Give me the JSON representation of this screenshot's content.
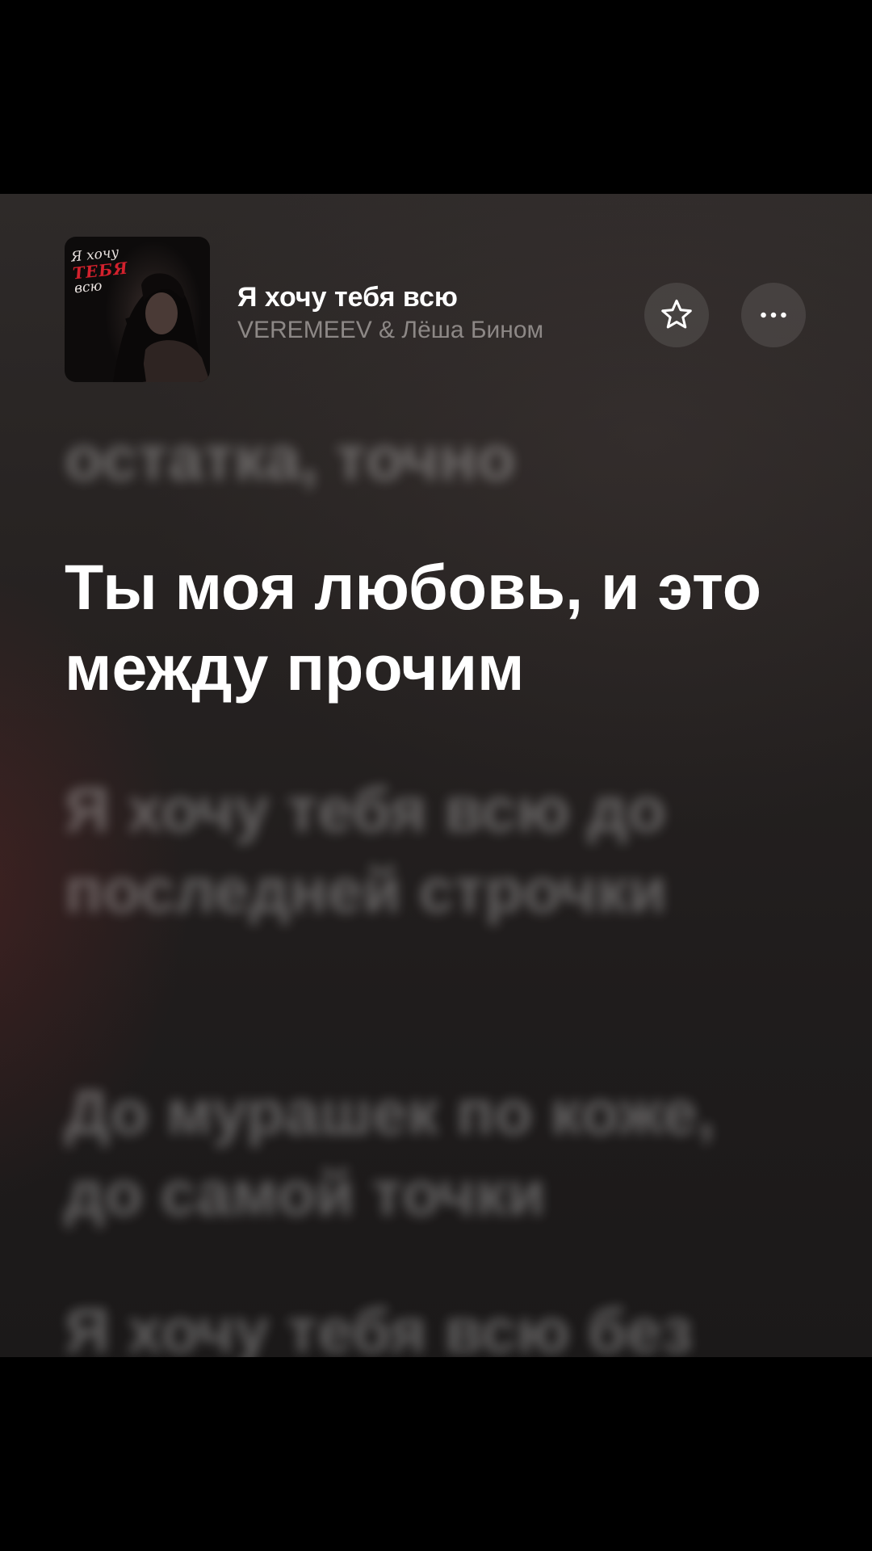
{
  "track": {
    "title": "Я хочу тебя всю",
    "artist": "VEREMEEV & Лёша Бином",
    "cover": {
      "line1": "Я хочу",
      "line2": "ТЕБЯ",
      "line3": "всю"
    }
  },
  "buttons": {
    "favorite_icon": "star-outline-icon",
    "more_icon": "ellipsis-icon"
  },
  "lyrics": {
    "previous": "остатка, точно",
    "current": "Ты моя любовь, и это между прочим",
    "next": [
      "Я хочу тебя всю до последней строчки",
      "До мурашек по коже, до самой точки",
      "Я хочу тебя всю без"
    ]
  },
  "colors": {
    "background": "#262221",
    "active_lyric": "#ffffff",
    "inactive_lyric": "rgba(255,255,255,0.30)",
    "artist_text": "#8d8886",
    "accent_red": "#d3212d"
  }
}
